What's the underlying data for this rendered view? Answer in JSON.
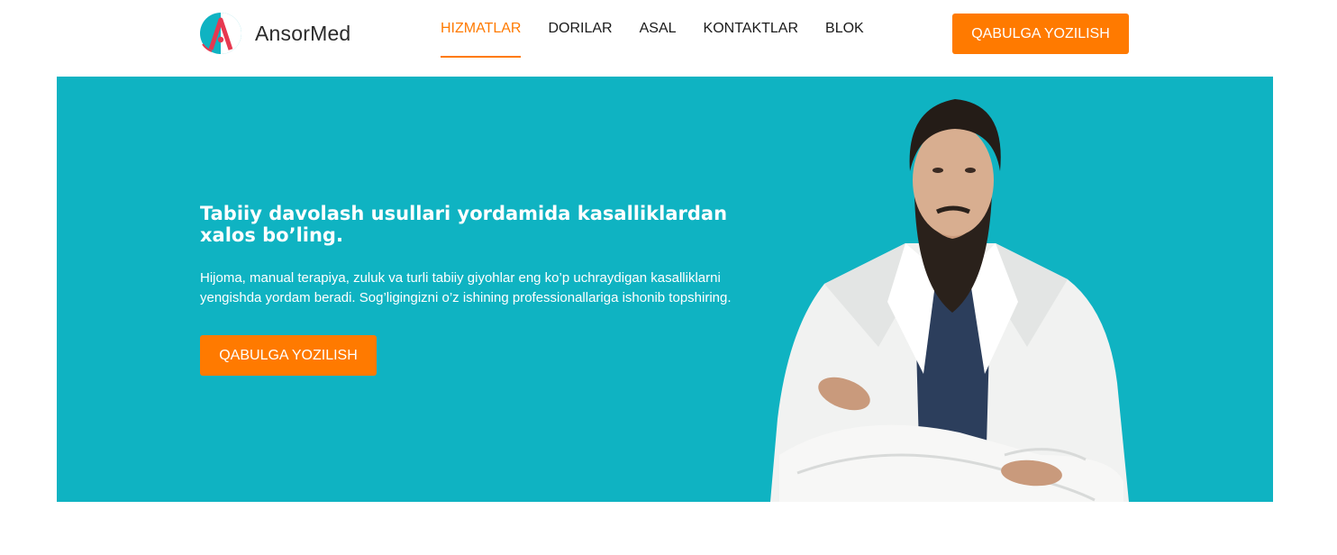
{
  "brand": {
    "name": "AnsorMed",
    "accent": "#ff7a00",
    "teal": "#0fb3c2",
    "logo_red": "#e63950"
  },
  "nav": {
    "items": [
      {
        "label": "HIZMATLAR",
        "active": true
      },
      {
        "label": "DORILAR",
        "active": false
      },
      {
        "label": "ASAL",
        "active": false
      },
      {
        "label": "KONTAKTLAR",
        "active": false
      },
      {
        "label": "BLOK",
        "active": false
      }
    ]
  },
  "header": {
    "cta_label": "QABULGA YOZILISH"
  },
  "hero": {
    "title": "Tabiiy davolash usullari yordamida kasalliklardan xalos bo’ling.",
    "description": "Hijoma, manual terapiya, zuluk va turli tabiiy giyohlar eng ko’p uchraydigan kasalliklarni yengishda yordam beradi. Sog’ligingizni o’z ishining professionallariga ishonib topshiring.",
    "cta_label": "QABULGA YOZILISH",
    "image": "doctor-portrait"
  }
}
